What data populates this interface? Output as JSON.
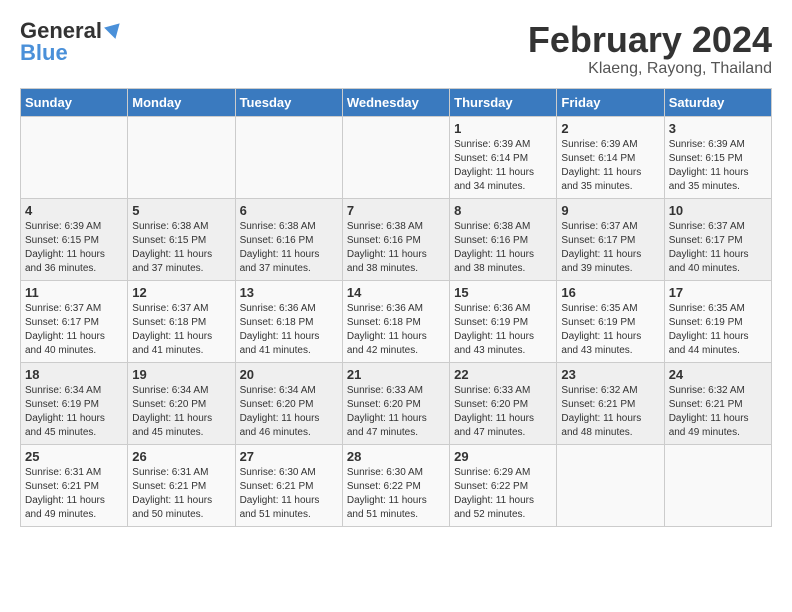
{
  "header": {
    "logo_general": "General",
    "logo_blue": "Blue",
    "month_title": "February 2024",
    "location": "Klaeng, Rayong, Thailand"
  },
  "days_of_week": [
    "Sunday",
    "Monday",
    "Tuesday",
    "Wednesday",
    "Thursday",
    "Friday",
    "Saturday"
  ],
  "weeks": [
    [
      {
        "day": "",
        "info": ""
      },
      {
        "day": "",
        "info": ""
      },
      {
        "day": "",
        "info": ""
      },
      {
        "day": "",
        "info": ""
      },
      {
        "day": "1",
        "info": "Sunrise: 6:39 AM\nSunset: 6:14 PM\nDaylight: 11 hours\nand 34 minutes."
      },
      {
        "day": "2",
        "info": "Sunrise: 6:39 AM\nSunset: 6:14 PM\nDaylight: 11 hours\nand 35 minutes."
      },
      {
        "day": "3",
        "info": "Sunrise: 6:39 AM\nSunset: 6:15 PM\nDaylight: 11 hours\nand 35 minutes."
      }
    ],
    [
      {
        "day": "4",
        "info": "Sunrise: 6:39 AM\nSunset: 6:15 PM\nDaylight: 11 hours\nand 36 minutes."
      },
      {
        "day": "5",
        "info": "Sunrise: 6:38 AM\nSunset: 6:15 PM\nDaylight: 11 hours\nand 37 minutes."
      },
      {
        "day": "6",
        "info": "Sunrise: 6:38 AM\nSunset: 6:16 PM\nDaylight: 11 hours\nand 37 minutes."
      },
      {
        "day": "7",
        "info": "Sunrise: 6:38 AM\nSunset: 6:16 PM\nDaylight: 11 hours\nand 38 minutes."
      },
      {
        "day": "8",
        "info": "Sunrise: 6:38 AM\nSunset: 6:16 PM\nDaylight: 11 hours\nand 38 minutes."
      },
      {
        "day": "9",
        "info": "Sunrise: 6:37 AM\nSunset: 6:17 PM\nDaylight: 11 hours\nand 39 minutes."
      },
      {
        "day": "10",
        "info": "Sunrise: 6:37 AM\nSunset: 6:17 PM\nDaylight: 11 hours\nand 40 minutes."
      }
    ],
    [
      {
        "day": "11",
        "info": "Sunrise: 6:37 AM\nSunset: 6:17 PM\nDaylight: 11 hours\nand 40 minutes."
      },
      {
        "day": "12",
        "info": "Sunrise: 6:37 AM\nSunset: 6:18 PM\nDaylight: 11 hours\nand 41 minutes."
      },
      {
        "day": "13",
        "info": "Sunrise: 6:36 AM\nSunset: 6:18 PM\nDaylight: 11 hours\nand 41 minutes."
      },
      {
        "day": "14",
        "info": "Sunrise: 6:36 AM\nSunset: 6:18 PM\nDaylight: 11 hours\nand 42 minutes."
      },
      {
        "day": "15",
        "info": "Sunrise: 6:36 AM\nSunset: 6:19 PM\nDaylight: 11 hours\nand 43 minutes."
      },
      {
        "day": "16",
        "info": "Sunrise: 6:35 AM\nSunset: 6:19 PM\nDaylight: 11 hours\nand 43 minutes."
      },
      {
        "day": "17",
        "info": "Sunrise: 6:35 AM\nSunset: 6:19 PM\nDaylight: 11 hours\nand 44 minutes."
      }
    ],
    [
      {
        "day": "18",
        "info": "Sunrise: 6:34 AM\nSunset: 6:19 PM\nDaylight: 11 hours\nand 45 minutes."
      },
      {
        "day": "19",
        "info": "Sunrise: 6:34 AM\nSunset: 6:20 PM\nDaylight: 11 hours\nand 45 minutes."
      },
      {
        "day": "20",
        "info": "Sunrise: 6:34 AM\nSunset: 6:20 PM\nDaylight: 11 hours\nand 46 minutes."
      },
      {
        "day": "21",
        "info": "Sunrise: 6:33 AM\nSunset: 6:20 PM\nDaylight: 11 hours\nand 47 minutes."
      },
      {
        "day": "22",
        "info": "Sunrise: 6:33 AM\nSunset: 6:20 PM\nDaylight: 11 hours\nand 47 minutes."
      },
      {
        "day": "23",
        "info": "Sunrise: 6:32 AM\nSunset: 6:21 PM\nDaylight: 11 hours\nand 48 minutes."
      },
      {
        "day": "24",
        "info": "Sunrise: 6:32 AM\nSunset: 6:21 PM\nDaylight: 11 hours\nand 49 minutes."
      }
    ],
    [
      {
        "day": "25",
        "info": "Sunrise: 6:31 AM\nSunset: 6:21 PM\nDaylight: 11 hours\nand 49 minutes."
      },
      {
        "day": "26",
        "info": "Sunrise: 6:31 AM\nSunset: 6:21 PM\nDaylight: 11 hours\nand 50 minutes."
      },
      {
        "day": "27",
        "info": "Sunrise: 6:30 AM\nSunset: 6:21 PM\nDaylight: 11 hours\nand 51 minutes."
      },
      {
        "day": "28",
        "info": "Sunrise: 6:30 AM\nSunset: 6:22 PM\nDaylight: 11 hours\nand 51 minutes."
      },
      {
        "day": "29",
        "info": "Sunrise: 6:29 AM\nSunset: 6:22 PM\nDaylight: 11 hours\nand 52 minutes."
      },
      {
        "day": "",
        "info": ""
      },
      {
        "day": "",
        "info": ""
      }
    ]
  ]
}
